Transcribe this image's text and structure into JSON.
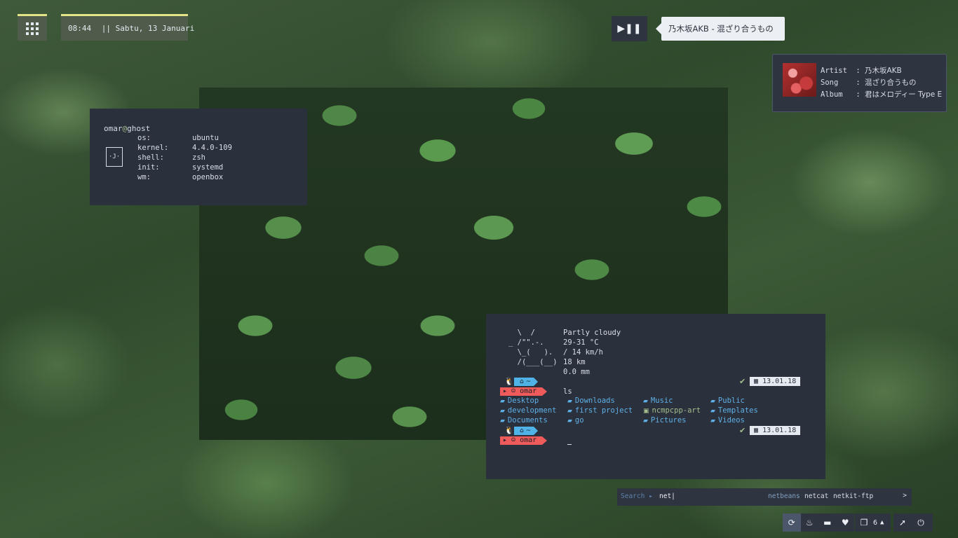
{
  "topbar": {
    "clock": "08:44",
    "separator": "||",
    "date": "Sabtu, 13 Januari"
  },
  "player": {
    "play_pause_icon": "play-pause-icon",
    "now_playing": "乃木坂AKB - 混ざり合うもの"
  },
  "music_card": {
    "artist_label": "Artist",
    "artist": "乃木坂AKB",
    "song_label": "Song",
    "song": "混ざり合うもの",
    "album_label": "Album",
    "album": "君はメロディー Type E",
    "colon": ":"
  },
  "sysinfo": {
    "user": "omar",
    "at": "@",
    "host": "ghost",
    "logo": "·J·",
    "rows": [
      {
        "key": "os:",
        "value": "ubuntu"
      },
      {
        "key": "kernel:",
        "value": "4.4.0-109"
      },
      {
        "key": "shell:",
        "value": "zsh"
      },
      {
        "key": "init:",
        "value": "systemd"
      },
      {
        "key": "wm:",
        "value": "openbox"
      }
    ]
  },
  "terminal": {
    "weather_art": "  \\  /\n_ /\"\".-.\n  \\_(   ).\n  /(___(__)",
    "weather_lines": [
      "Partly cloudy",
      "29-31 °C",
      "/ 14 km/h",
      "18 km",
      "0.0 mm"
    ],
    "home_segment": "~",
    "user_segment": "omar",
    "command": "ls",
    "date": "13.01.18",
    "listing": [
      {
        "name": "Desktop",
        "type": "dir"
      },
      {
        "name": "Downloads",
        "type": "dir"
      },
      {
        "name": "Music",
        "type": "dir"
      },
      {
        "name": "Public",
        "type": "dir"
      },
      {
        "name": "development",
        "type": "dir"
      },
      {
        "name": "first project",
        "type": "dir"
      },
      {
        "name": "ncmpcpp-art",
        "type": "exe"
      },
      {
        "name": "Templates",
        "type": "dir"
      },
      {
        "name": "Documents",
        "type": "dir"
      },
      {
        "name": "go",
        "type": "dir"
      },
      {
        "name": "Pictures",
        "type": "dir"
      },
      {
        "name": "Videos",
        "type": "dir"
      }
    ]
  },
  "launcher": {
    "label": "Search",
    "query": "net|",
    "suggestions": [
      "netbeans",
      "netcat",
      "netkit-ftp"
    ],
    "more": ">"
  },
  "dock": {
    "workspace_count": "6",
    "icons": [
      "refresh-icon",
      "fire-icon",
      "folder-icon",
      "heartbeat-icon",
      "windows-icon",
      "rocket-icon",
      "power-icon"
    ]
  },
  "colors": {
    "accent_yellow": "#e3e388",
    "panel_bg": "#2b313c",
    "prompt_blue": "#4fb3e8",
    "prompt_red": "#ef5b5b",
    "exe_green": "#a3be8c"
  }
}
